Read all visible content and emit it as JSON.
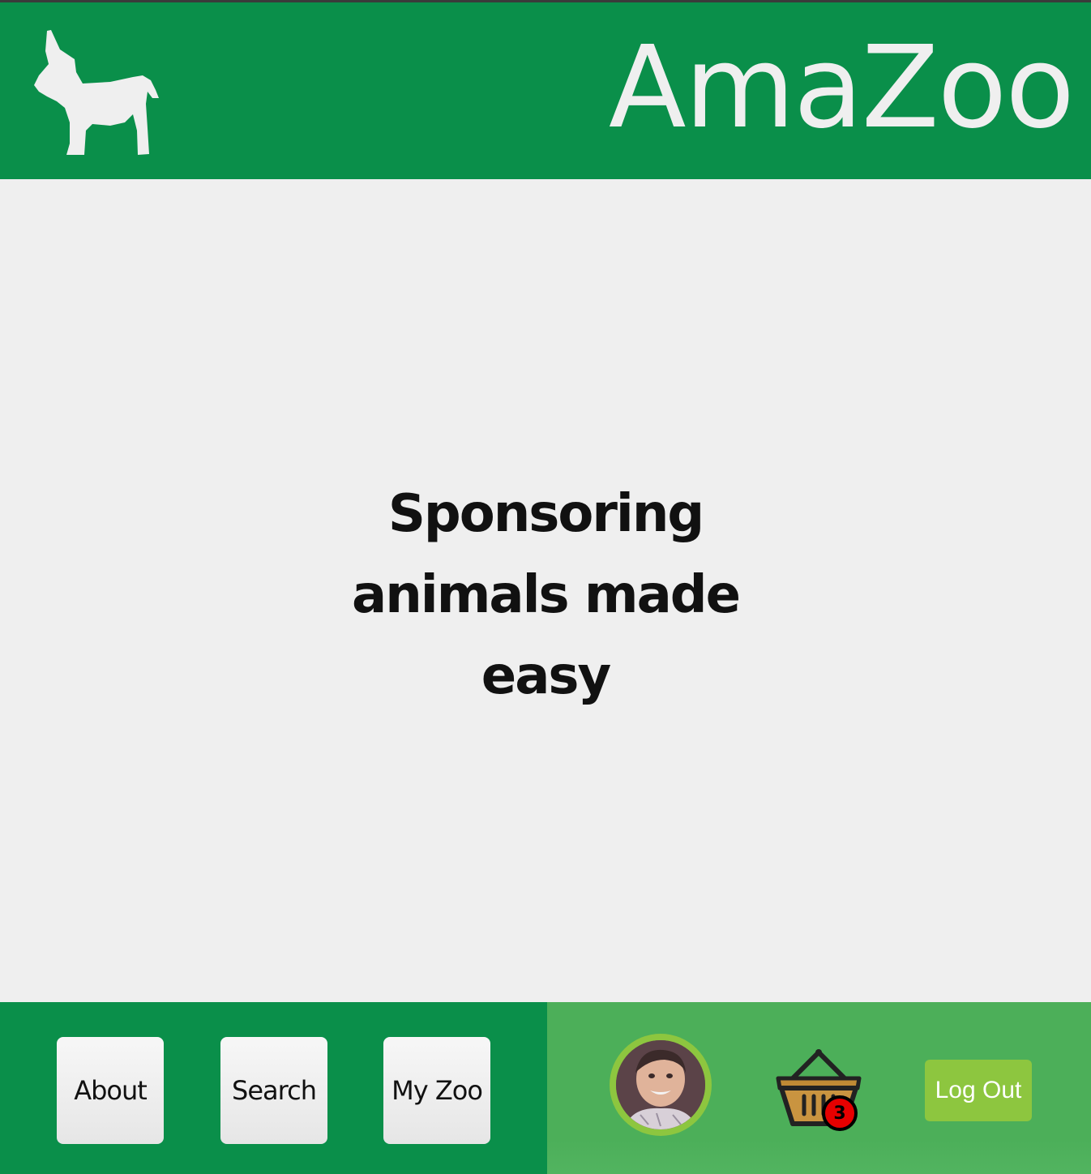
{
  "header": {
    "brand": "AmaZoo",
    "logo_icon": "donkey-icon"
  },
  "hero": {
    "tagline_lines": [
      "Sponsoring",
      "animals made",
      "easy"
    ]
  },
  "nav": {
    "about_label": "About",
    "search_label": "Search",
    "myzoo_label": "My Zoo"
  },
  "user": {
    "avatar_icon": "user-avatar",
    "basket_icon": "basket-icon",
    "basket_count": "3",
    "logout_label": "Log Out"
  },
  "colors": {
    "primary_green": "#0a8f4a",
    "secondary_green": "#4caf59",
    "accent_lime": "#8dc63f",
    "background": "#efefef",
    "badge_red": "#e60000"
  }
}
